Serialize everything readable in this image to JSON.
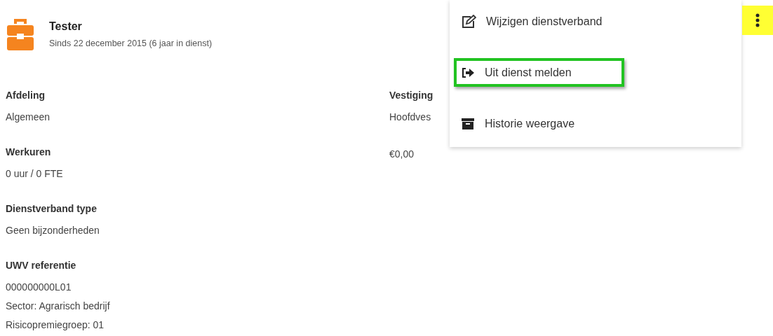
{
  "header": {
    "title": "Tester",
    "subtitle": "Sinds 22 december 2015 (6 jaar in dienst)"
  },
  "left_fields": [
    {
      "label": "Afdeling",
      "values": [
        "Algemeen"
      ]
    },
    {
      "label": "Werkuren",
      "values": [
        "0 uur / 0 FTE"
      ]
    },
    {
      "label": "Dienstverband type",
      "values": [
        "Geen bijzonderheden"
      ]
    },
    {
      "label": "UWV referentie",
      "values": [
        "000000000L01",
        "Sector: Agrarisch bedrijf",
        "Risicopremiegroep: 01"
      ]
    }
  ],
  "right_fields": [
    {
      "label": "Vestiging",
      "values": [
        "Hoofdves"
      ]
    },
    {
      "values": [
        "€0,00"
      ]
    }
  ],
  "menu": {
    "items": [
      {
        "label": "Wijzigen dienstverband",
        "kind": "edit",
        "highlighted": false
      },
      {
        "label": "Uit dienst melden",
        "kind": "exit",
        "highlighted": true
      },
      {
        "label": "Historie weergave",
        "kind": "archive",
        "highlighted": false
      }
    ]
  },
  "more_button": {
    "active": true
  }
}
